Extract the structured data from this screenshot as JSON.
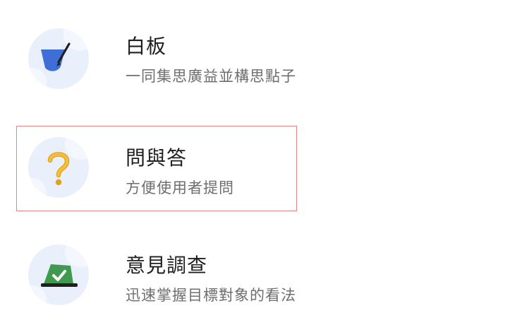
{
  "items": [
    {
      "title": "白板",
      "subtitle": "一同集思廣益並構思點子",
      "icon": "whiteboard-icon",
      "color": "#3f6fd6"
    },
    {
      "title": "問與答",
      "subtitle": "方便使用者提問",
      "icon": "question-mark-icon",
      "color": "#f0b323",
      "highlighted": true
    },
    {
      "title": "意見調查",
      "subtitle": "迅速掌握目標對象的看法",
      "icon": "poll-icon",
      "color": "#3f9a4f"
    }
  ],
  "colors": {
    "highlight_border": "#e8837f",
    "icon_background": "#eaf0fb",
    "title_text": "#1f1f1f",
    "subtitle_text": "#6e6e6e"
  }
}
